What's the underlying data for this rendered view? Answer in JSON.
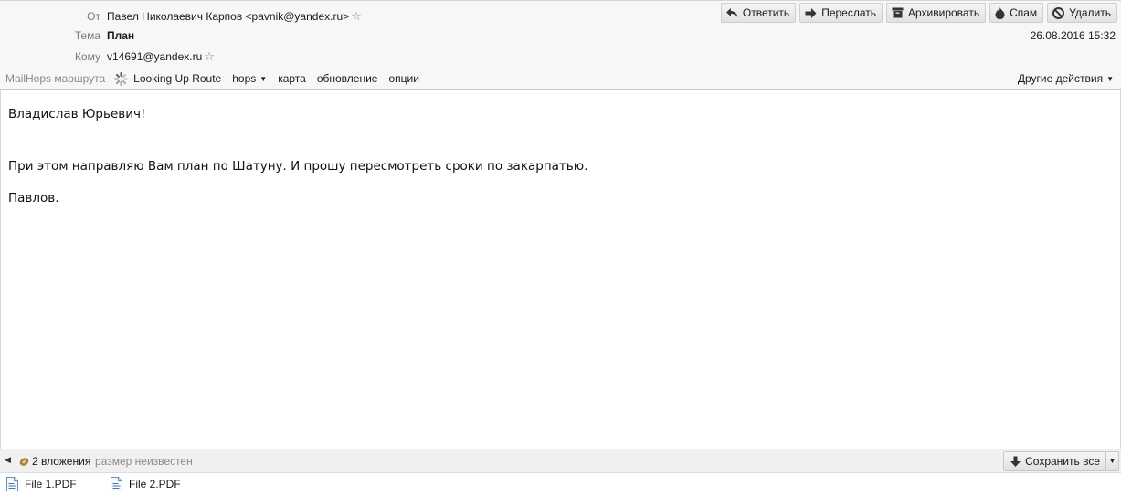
{
  "header": {
    "from_label": "От",
    "from_value": "Павел Николаевич Карпов <pavnik@yandex.ru>",
    "subject_label": "Тема",
    "subject_value": "План",
    "to_label": "Кому",
    "to_value": "v14691@yandex.ru",
    "date": "26.08.2016 15:32",
    "star_icon": "star-outline-icon"
  },
  "toolbar": {
    "reply_label": "Ответить",
    "forward_label": "Переслать",
    "archive_label": "Архивировать",
    "spam_label": "Спам",
    "delete_label": "Удалить"
  },
  "mailhops": {
    "label": "MailHops маршрута",
    "route_status": "Looking Up Route",
    "hops_label": "hops",
    "map_label": "карта",
    "refresh_label": "обновление",
    "options_label": "опции"
  },
  "other_actions_label": "Другие действия",
  "message": {
    "greeting": "Владислав Юрьевич!",
    "paragraph": "При этом направляю Вам план по Шатуну. И прошу пересмотреть сроки по закарпатью.",
    "signature": "Павлов."
  },
  "attachments": {
    "count_label": "2 вложения",
    "size_label": "размер неизвестен",
    "save_all_label": "Сохранить все",
    "files": [
      {
        "name": "File 1.PDF"
      },
      {
        "name": "File 2.PDF"
      }
    ]
  },
  "colors": {
    "header_bg": "#f7f7f7",
    "muted_text": "#7a7a7a",
    "attach_bar_bg": "#f0f0f0"
  }
}
